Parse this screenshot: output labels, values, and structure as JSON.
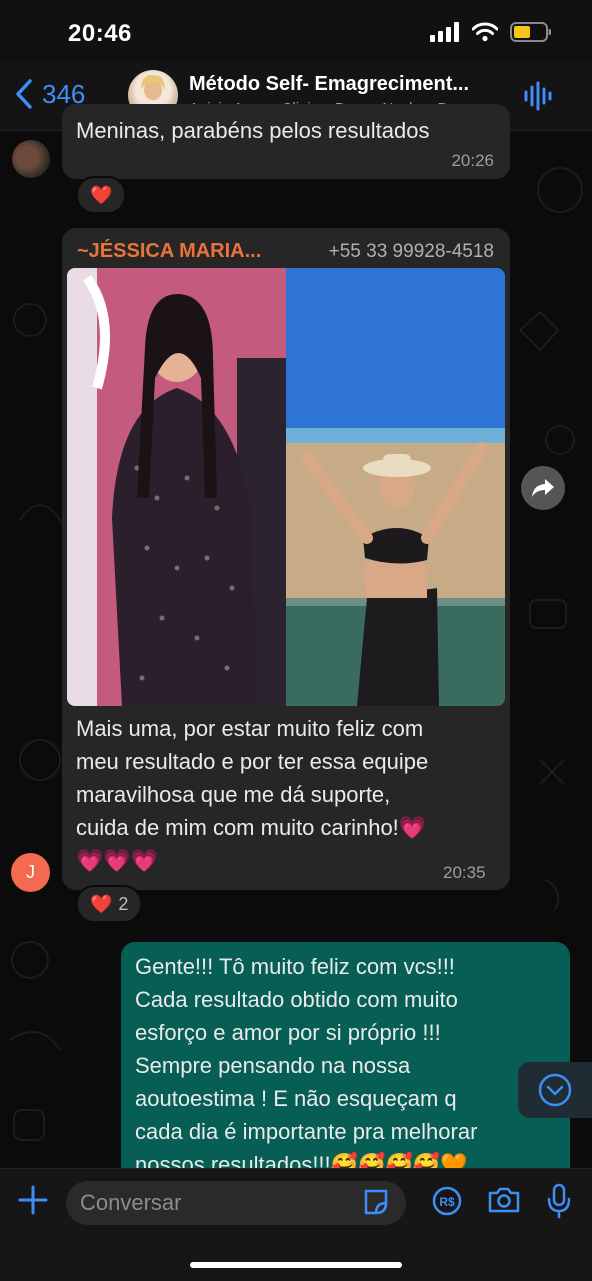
{
  "status_bar": {
    "time": "20:46"
  },
  "header": {
    "back_count": "346",
    "title": "Método Self- Emagreciment...",
    "subtitle": "Anisio Amor , Clinica, Danny Nucleo, D..."
  },
  "messages": [
    {
      "text": "Meninas, parabéns pelos resultados",
      "time": "20:26",
      "reaction": "❤️"
    },
    {
      "sender": "~JÉSSICA MARIA...",
      "phone": "+55 33 99928-4518",
      "avatar_initial": "J",
      "text_lines": [
        "Mais uma, por estar muito feliz com",
        "meu resultado e por ter essa equipe",
        "maravilhosa que me dá suporte,",
        "cuida de mim com muito carinho!💗",
        "💗💗💗"
      ],
      "time": "20:35",
      "reaction": "❤️",
      "reaction_count": "2"
    },
    {
      "outgoing": true,
      "text_lines": [
        "Gente!!! Tô muito feliz com vcs!!!",
        "Cada resultado obtido com muito",
        "esforço e amor por si próprio !!!",
        "Sempre pensando na nossa",
        "aoutoestima !  E não esqueçam q",
        "cada dia é importante pra melhorar",
        "nossos resultados!!!🥰🥰🥰🥰🧡"
      ]
    }
  ],
  "composer": {
    "placeholder": "Conversar"
  },
  "colors": {
    "accent": "#3e8ef7",
    "sender_name": "#e8743b",
    "outgoing_bubble": "#075e54",
    "incoming_bubble": "#262626"
  },
  "icons": [
    "back-chevron-icon",
    "voice-call-icon",
    "forward-icon",
    "scroll-down-icon",
    "plus-icon",
    "sticker-icon",
    "payment-icon",
    "camera-icon",
    "mic-icon"
  ]
}
